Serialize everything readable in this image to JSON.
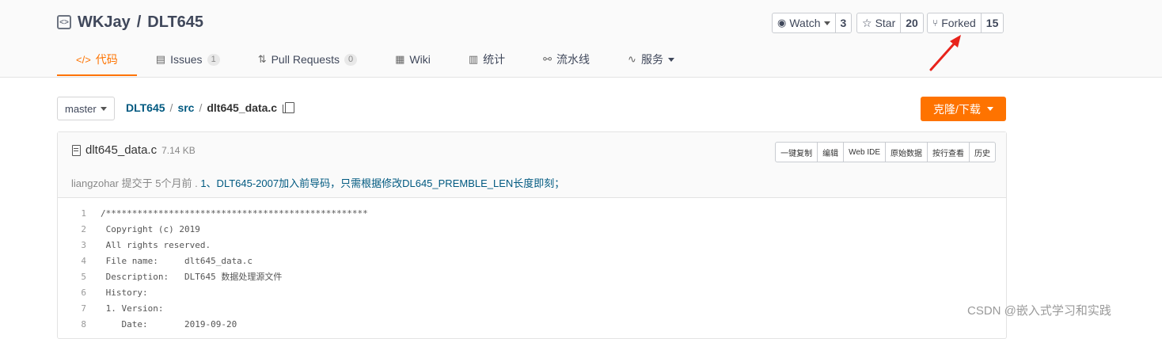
{
  "repo": {
    "owner": "WKJay",
    "separator": "/",
    "name": "DLT645"
  },
  "actions": {
    "watch": {
      "label": "Watch",
      "count": "3"
    },
    "star": {
      "label": "Star",
      "count": "20"
    },
    "forked": {
      "label": "Forked",
      "count": "15"
    }
  },
  "tabs": [
    {
      "label": "代码"
    },
    {
      "label": "Issues",
      "badge": "1"
    },
    {
      "label": "Pull Requests",
      "badge": "0"
    },
    {
      "label": "Wiki"
    },
    {
      "label": "统计"
    },
    {
      "label": "流水线"
    },
    {
      "label": "服务"
    }
  ],
  "branch": "master",
  "breadcrumb": {
    "root": "DLT645",
    "sep": "/",
    "dir": "src",
    "file": "dlt645_data.c"
  },
  "clone_label": "克隆/下载",
  "file": {
    "name": "dlt645_data.c",
    "size": "7.14 KB",
    "buttons": [
      "一键复制",
      "编辑",
      "Web IDE",
      "原始数据",
      "按行查看",
      "历史"
    ],
    "commit": {
      "author": "liangzohar",
      "when": "提交于 5个月前 .",
      "message": "1、DLT645-2007加入前导码，只需根据修改DL645_PREMBLE_LEN长度即刻；"
    },
    "lines": [
      {
        "n": "1",
        "t": "/**************************************************"
      },
      {
        "n": "2",
        "t": " Copyright (c) 2019"
      },
      {
        "n": "3",
        "t": " All rights reserved."
      },
      {
        "n": "4",
        "t": " File name:     dlt645_data.c"
      },
      {
        "n": "5",
        "t": " Description:   DLT645 数据处理源文件"
      },
      {
        "n": "6",
        "t": " History:"
      },
      {
        "n": "7",
        "t": " 1. Version:"
      },
      {
        "n": "8",
        "t": "    Date:       2019-09-20"
      }
    ]
  },
  "watermark": "CSDN @嵌入式学习和实践",
  "colors": {
    "accent": "#fe7300",
    "link": "#005980",
    "annotation_arrow": "#e8231b"
  }
}
